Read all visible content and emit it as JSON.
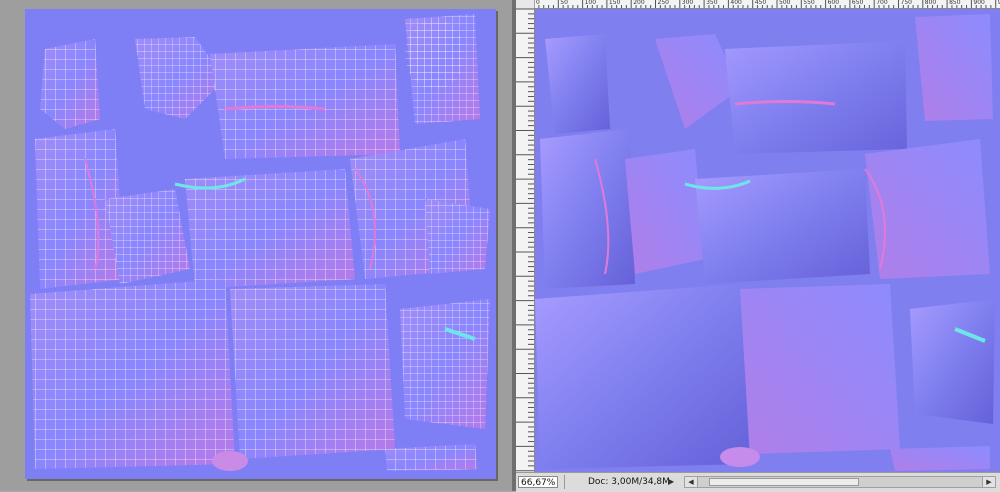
{
  "left_view": {
    "canvas_color": "#7f7ff5",
    "content": "uv-layout-wireframe-normal-map"
  },
  "right_window": {
    "canvas_color": "#7f7ff0",
    "ruler_top_labels": [
      "0",
      "50",
      "100",
      "150",
      "200",
      "250",
      "300",
      "350",
      "400",
      "450",
      "500",
      "550",
      "600",
      "650",
      "700",
      "750",
      "800",
      "850",
      "900",
      "950"
    ],
    "status_bar": {
      "zoom": "66,67%",
      "doc_info": "Doc: 3,00M/34,8M",
      "arrow": "▶"
    },
    "scroll": {
      "left_arrow": "◀",
      "right_arrow": "▶"
    }
  },
  "colors": {
    "normal_base": "#8080ff",
    "highlight_magenta": "#e07ad8",
    "highlight_cyan": "#6fe6e6",
    "wire": "#ffffff"
  }
}
